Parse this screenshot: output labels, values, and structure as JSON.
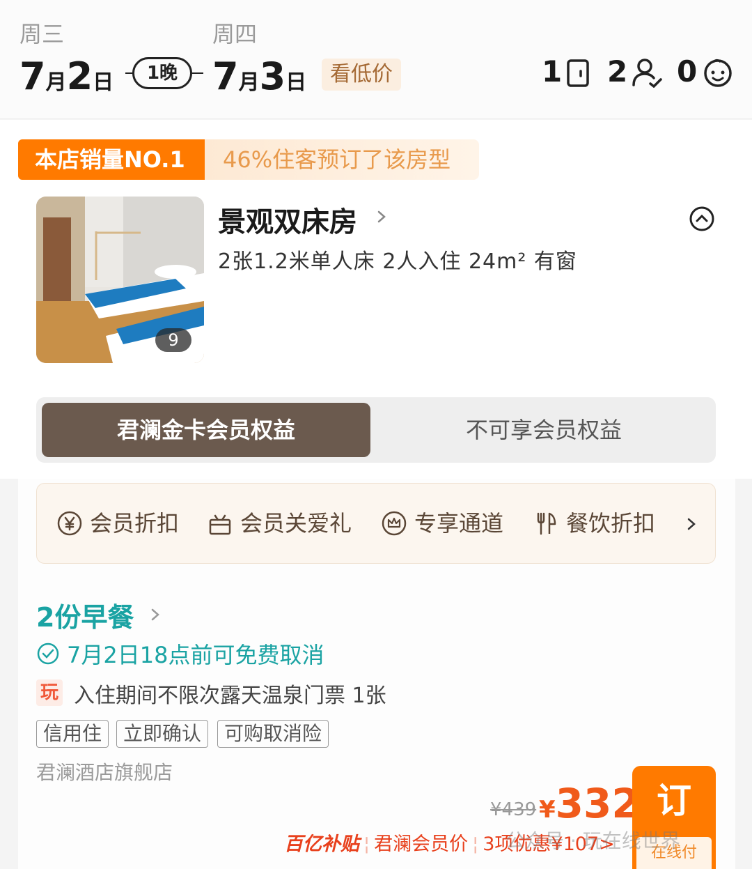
{
  "dates": {
    "checkin": {
      "weekday": "周三",
      "month": "7",
      "month_unit": "月",
      "day": "2",
      "day_unit": "日"
    },
    "checkout": {
      "weekday": "周四",
      "month": "7",
      "month_unit": "月",
      "day": "3",
      "day_unit": "日"
    },
    "nights": "1晚",
    "low_price_label": "看低价"
  },
  "guests": {
    "rooms": "1",
    "adults": "2",
    "children": "0"
  },
  "room": {
    "badge_primary": "本店销量NO.1",
    "badge_secondary": "46%住客预订了该房型",
    "name": "景观双床房",
    "specs": "2张1.2米单人床  2人入住  24m²  有窗",
    "photo_count": "9"
  },
  "tabs": {
    "active": "君澜金卡会员权益",
    "inactive": "不可享会员权益"
  },
  "perks": [
    {
      "label": "会员折扣",
      "icon": "yen-circle-icon"
    },
    {
      "label": "会员关爱礼",
      "icon": "gift-icon"
    },
    {
      "label": "专享通道",
      "icon": "crown-icon"
    },
    {
      "label": "餐饮折扣",
      "icon": "utensils-icon"
    }
  ],
  "plan": {
    "breakfast": "2份早餐",
    "cancel": "7月2日18点前可免费取消",
    "play_tag": "玩",
    "play_text": "入住期间不限次露天温泉门票 1张",
    "tags": [
      "信用住",
      "立即确认",
      "可购取消险"
    ],
    "store": "君澜酒店旗舰店"
  },
  "price": {
    "original": "¥439",
    "currency": "¥",
    "amount": "332",
    "book_label": "订",
    "book_sub": "在线付"
  },
  "promo": {
    "subsidy": "百亿补贴",
    "member_price": "君澜会员价",
    "discount": "3项优惠¥107>"
  },
  "watermark": "公众号 · 玩在线世界",
  "colors": {
    "accent": "#ff7a00",
    "teal": "#1aa3a3",
    "price": "#f05a1a",
    "member_tab": "#6b5a4e"
  }
}
